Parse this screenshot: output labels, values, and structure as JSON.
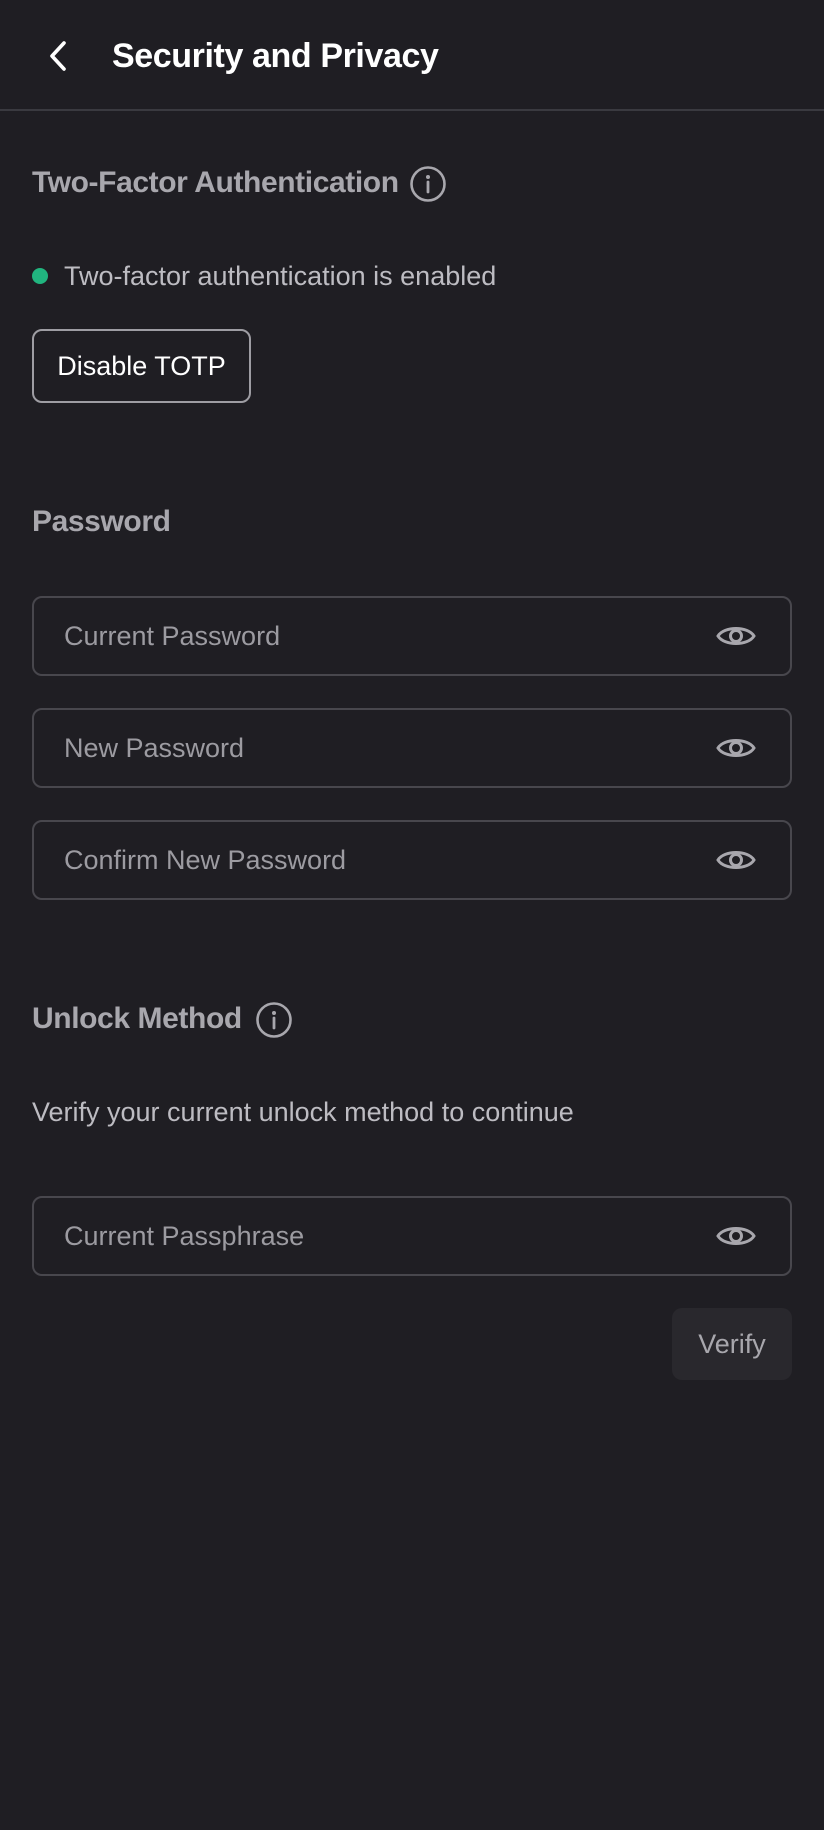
{
  "header": {
    "title": "Security and Privacy",
    "back_icon": "chevron-left-icon"
  },
  "two_factor": {
    "heading": "Two-Factor Authentication",
    "info_icon": "info-icon",
    "status_text": "Two-factor authentication is enabled",
    "status_color": "#21b57f",
    "disable_button_label": "Disable TOTP"
  },
  "password": {
    "heading": "Password",
    "fields": [
      {
        "placeholder": "Current Password",
        "value": "",
        "icon": "eye-icon"
      },
      {
        "placeholder": "New Password",
        "value": "",
        "icon": "eye-icon"
      },
      {
        "placeholder": "Confirm New Password",
        "value": "",
        "icon": "eye-icon"
      }
    ]
  },
  "unlock": {
    "heading": "Unlock Method",
    "info_icon": "info-icon",
    "description": "Verify your current unlock method to continue",
    "passphrase_placeholder": "Current Passphrase",
    "passphrase_value": "",
    "verify_label": "Verify"
  },
  "colors": {
    "background": "#1f1e23",
    "accent_green": "#21b57f"
  }
}
